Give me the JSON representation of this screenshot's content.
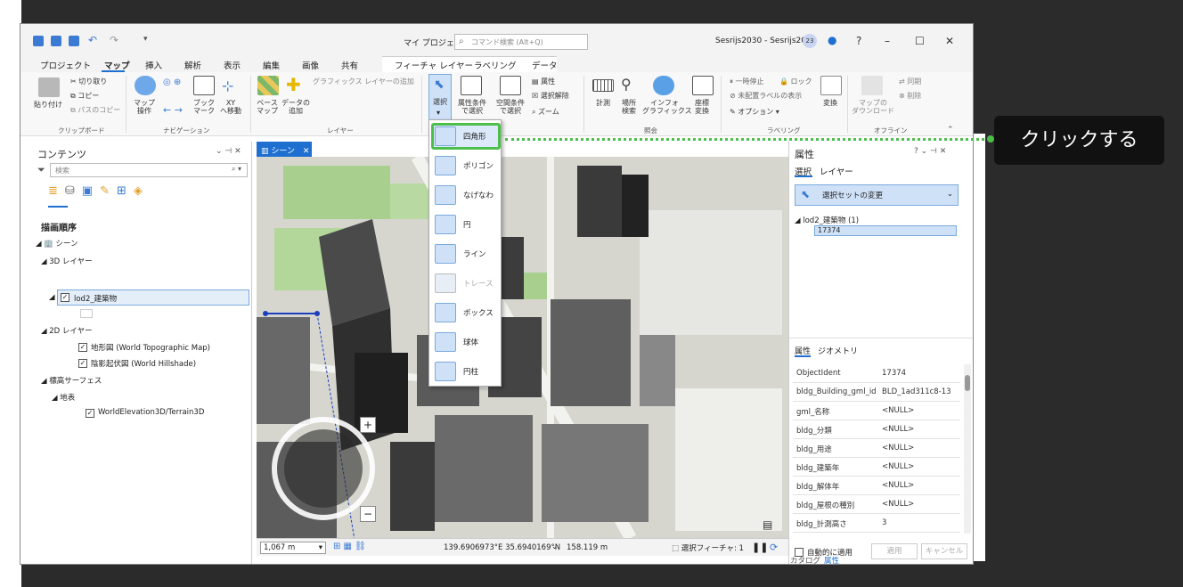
{
  "titlebar": {
    "project": "マイ プロジェクト",
    "search_placeholder": "コマンド検索 (Alt+Q)",
    "user": "Sesrijs2030 - Sesrijs2030",
    "user_badge": "23"
  },
  "tabs": [
    "プロジェクト",
    "マップ",
    "挿入",
    "解析",
    "表示",
    "編集",
    "画像",
    "共有"
  ],
  "context_tabs": [
    "フィーチャ レイヤー",
    "ラベリング",
    "データ"
  ],
  "ribbon": {
    "clipboard": {
      "paste": "貼り付け",
      "cut": "切り取り",
      "copy": "コピー",
      "copy_path": "パスのコピー",
      "group": "クリップボード"
    },
    "navigation": {
      "explore": "マップ\n操作",
      "bookmark": "ブック\nマーク",
      "xy": "XY\nへ移動",
      "group": "ナビゲーション"
    },
    "layer": {
      "basemap": "ベース\nマップ",
      "add_data": "データの\n追加",
      "add_graphics": "グラフィックス レイヤーの追加",
      "group": "レイヤー"
    },
    "selection": {
      "select": "選択",
      "by_attr": "属性条件\nで選択",
      "by_location": "空間条件\nで選択",
      "attributes": "属性",
      "clear": "選択解除",
      "zoom": "ズーム"
    },
    "inquiry": {
      "measure": "計測",
      "locate": "場所\n検索",
      "infographics": "インフォ\nグラフィックス",
      "convert": "座標\n変換",
      "group": "照会"
    },
    "labeling": {
      "pause": "一時停止",
      "lock": "ロック",
      "unplaced": "未配置ラベルの表示",
      "options": "オプション",
      "convert": "変換",
      "group": "ラベリング"
    },
    "offline": {
      "download": "マップの\nダウンロード",
      "sync": "同期",
      "remove": "削除",
      "group": "オフライン"
    }
  },
  "contents": {
    "title": "コンテンツ",
    "search_placeholder": "検索",
    "drawing_order": "描画順序",
    "scene": "シーン",
    "layers_3d": "3D レイヤー",
    "lod2": "lod2_建築物",
    "layers_2d": "2D レイヤー",
    "topo": "地形図 (World Topographic Map)",
    "hillshade": "陰影起伏図 (World Hillshade)",
    "elevation": "標高サーフェス",
    "ground": "地表",
    "terrain": "WorldElevation3D/Terrain3D"
  },
  "scene": {
    "tab": "シーン",
    "scale": "1,067 m",
    "coords": "139.6906973°E 35.6940169°N",
    "elevation": "158.119 m",
    "selected_features": "選択フィーチャ: 1"
  },
  "dropdown": [
    {
      "label": "四角形",
      "icon": "rectangle-select-icon"
    },
    {
      "label": "ポリゴン",
      "icon": "polygon-select-icon"
    },
    {
      "label": "なげなわ",
      "icon": "lasso-select-icon"
    },
    {
      "label": "円",
      "icon": "circle-select-icon"
    },
    {
      "label": "ライン",
      "icon": "line-select-icon"
    },
    {
      "label": "トレース",
      "icon": "trace-select-icon"
    },
    {
      "label": "ボックス",
      "icon": "box-select-icon"
    },
    {
      "label": "球体",
      "icon": "sphere-select-icon"
    },
    {
      "label": "円柱",
      "icon": "cylinder-select-icon"
    }
  ],
  "attributes": {
    "title": "属性",
    "tab_select": "選択",
    "tab_layer": "レイヤー",
    "change_selection": "選択セットの変更",
    "layer": "lod2_建築物 (1)",
    "feature_id": "17374",
    "sub_tab_attr": "属性",
    "sub_tab_geom": "ジオメトリ",
    "rows": [
      {
        "k": "ObjectIdent",
        "v": "17374"
      },
      {
        "k": "bldg_Building_gml_id",
        "v": "BLD_1ad311c8-13"
      },
      {
        "k": "gml_名称",
        "v": "<NULL>"
      },
      {
        "k": "bldg_分類",
        "v": "<NULL>"
      },
      {
        "k": "bldg_用途",
        "v": "<NULL>"
      },
      {
        "k": "bldg_建築年",
        "v": "<NULL>"
      },
      {
        "k": "bldg_解体年",
        "v": "<NULL>"
      },
      {
        "k": "bldg_屋根の種別",
        "v": "<NULL>"
      },
      {
        "k": "bldg_計測高さ",
        "v": "3"
      }
    ],
    "auto_apply": "自動的に適用",
    "apply": "適用",
    "cancel": "キャンセル",
    "catalog": "カタログ",
    "bottom_attr": "属性"
  },
  "callout": "クリックする",
  "colors": {
    "accent": "#1e6fd0",
    "highlight": "#4cbf4a"
  }
}
